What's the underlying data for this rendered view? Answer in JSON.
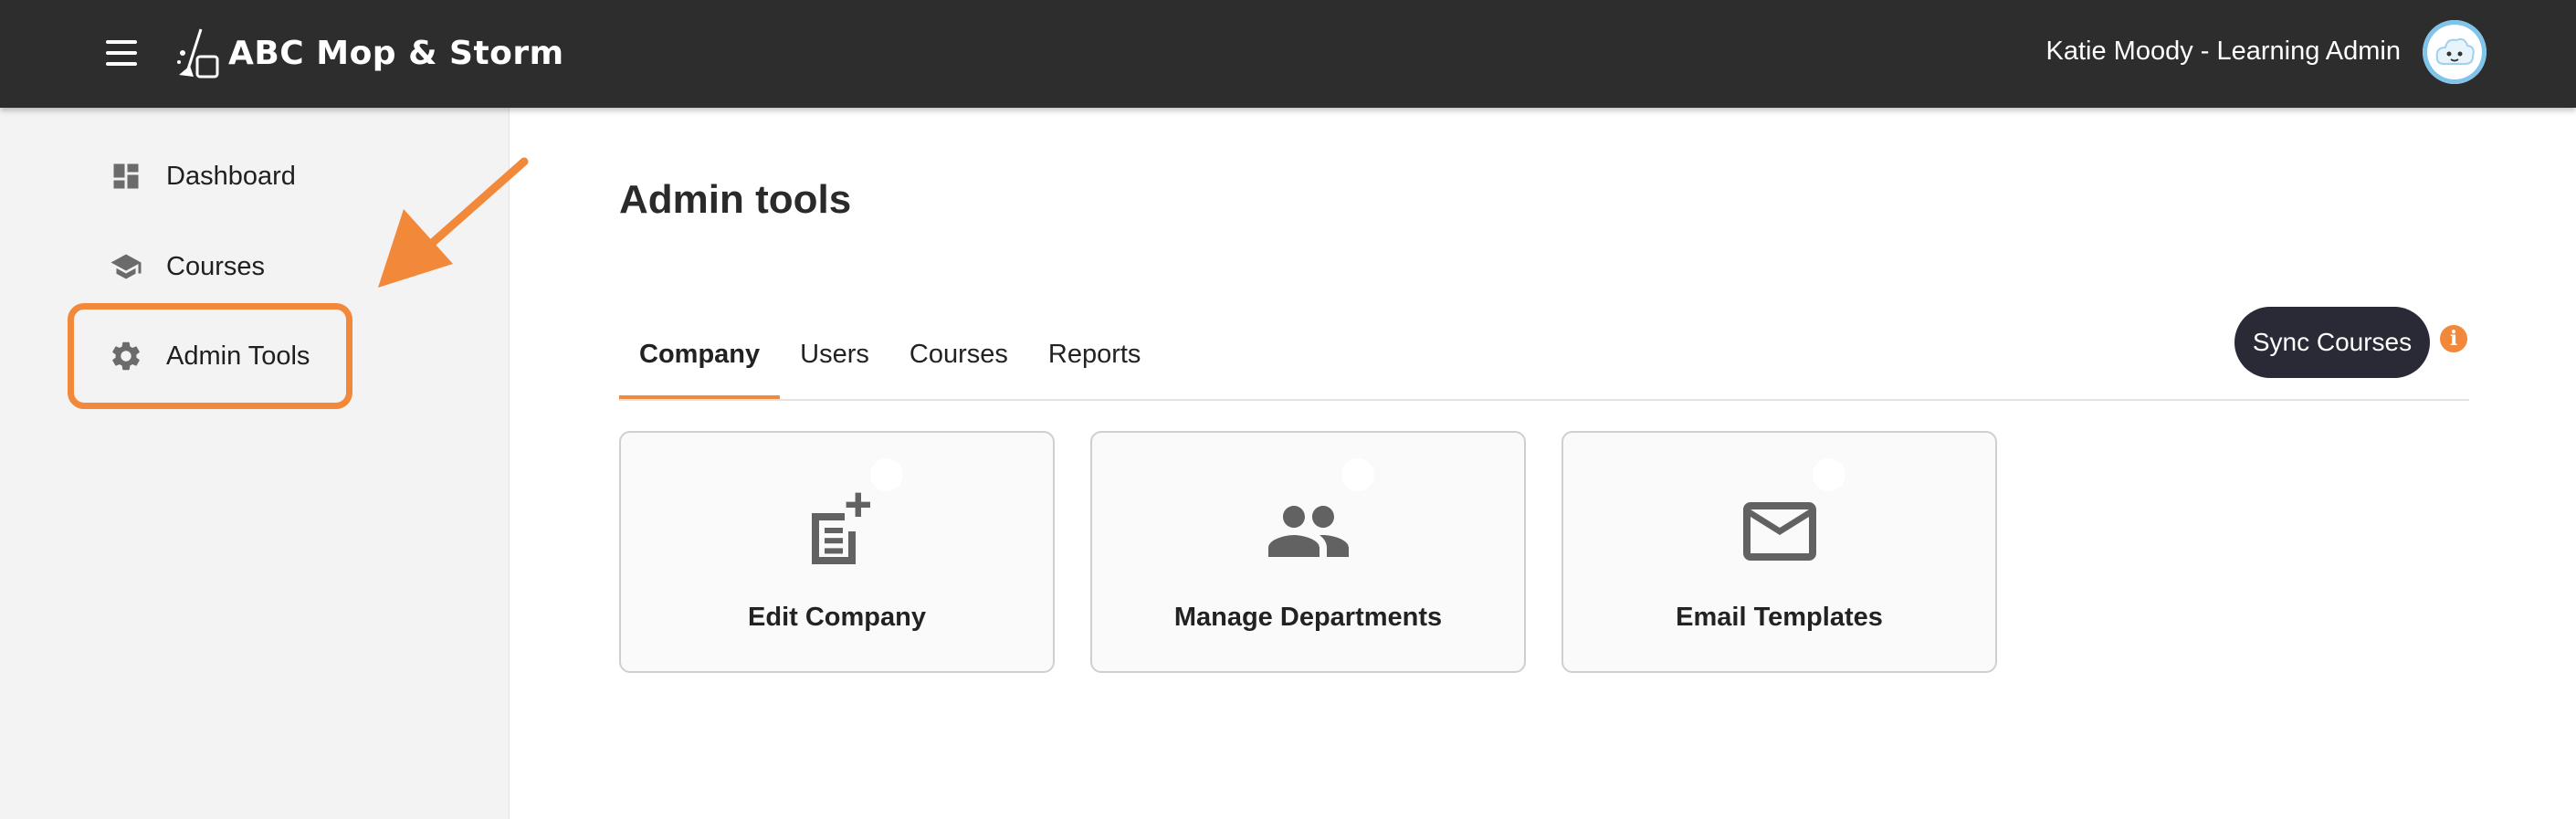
{
  "header": {
    "logo_text": "ABC Mop & Storm",
    "user_name": "Katie Moody - Learning Admin"
  },
  "sidebar": {
    "items": [
      {
        "label": "Dashboard",
        "icon": "dashboard-icon"
      },
      {
        "label": "Courses",
        "icon": "graduation-cap-icon"
      },
      {
        "label": "Admin Tools",
        "icon": "gear-icon"
      }
    ]
  },
  "main": {
    "title": "Admin tools",
    "tabs": [
      {
        "label": "Company",
        "active": true
      },
      {
        "label": "Users",
        "active": false
      },
      {
        "label": "Courses",
        "active": false
      },
      {
        "label": "Reports",
        "active": false
      }
    ],
    "sync_button": "Sync Courses",
    "info_glyph": "i",
    "cards": [
      {
        "label": "Edit Company",
        "icon": "note-add-icon"
      },
      {
        "label": "Manage Departments",
        "icon": "people-icon"
      },
      {
        "label": "Email Templates",
        "icon": "mail-icon"
      }
    ]
  },
  "colors": {
    "header_bg": "#2d2d2d",
    "accent": "#f2883a",
    "button_bg": "#2a2a36",
    "sidebar_bg": "#f3f3f3"
  }
}
